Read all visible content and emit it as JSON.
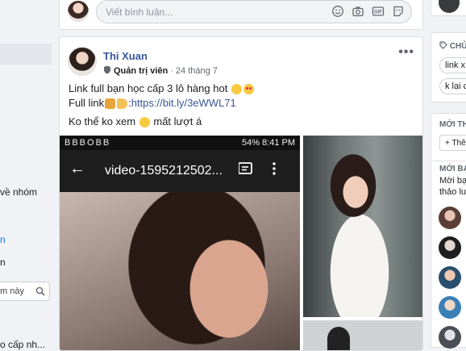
{
  "left": {
    "items": [
      "về nhóm",
      "n",
      "n"
    ],
    "search_label": "m này",
    "bottom_item": "o cấp nh..."
  },
  "comment": {
    "placeholder": "Viết bình luận..."
  },
  "post": {
    "author": "Thi Xuan",
    "role": "Quản trị viên",
    "date": "24 tháng 7",
    "more": "•••",
    "line1": "Link full bạn học cấp 3 lô hàng hot",
    "line2_prefix": "Full link",
    "line2_sep": " : ",
    "link": "https://bit.ly/3eWWL71",
    "line3": "Ko thể ko xem",
    "line3_suffix": "mất lượt á"
  },
  "phone": {
    "status_left": "BBBOBB",
    "status_right": "54% 8:41 PM",
    "title": "video-1595212502...",
    "back": "←"
  },
  "right": {
    "tags_header": "CHỦ",
    "tag1": "link x",
    "tag2": "k lại c",
    "members_header": "MỚI TH",
    "add_label": "+ Thê",
    "suggest_header": "MỚI BẠ",
    "suggest_line1": "Mời bạ",
    "suggest_line2": "thảo lu"
  },
  "colors": {
    "link": "#385898",
    "bg": "#f0f2f5"
  }
}
